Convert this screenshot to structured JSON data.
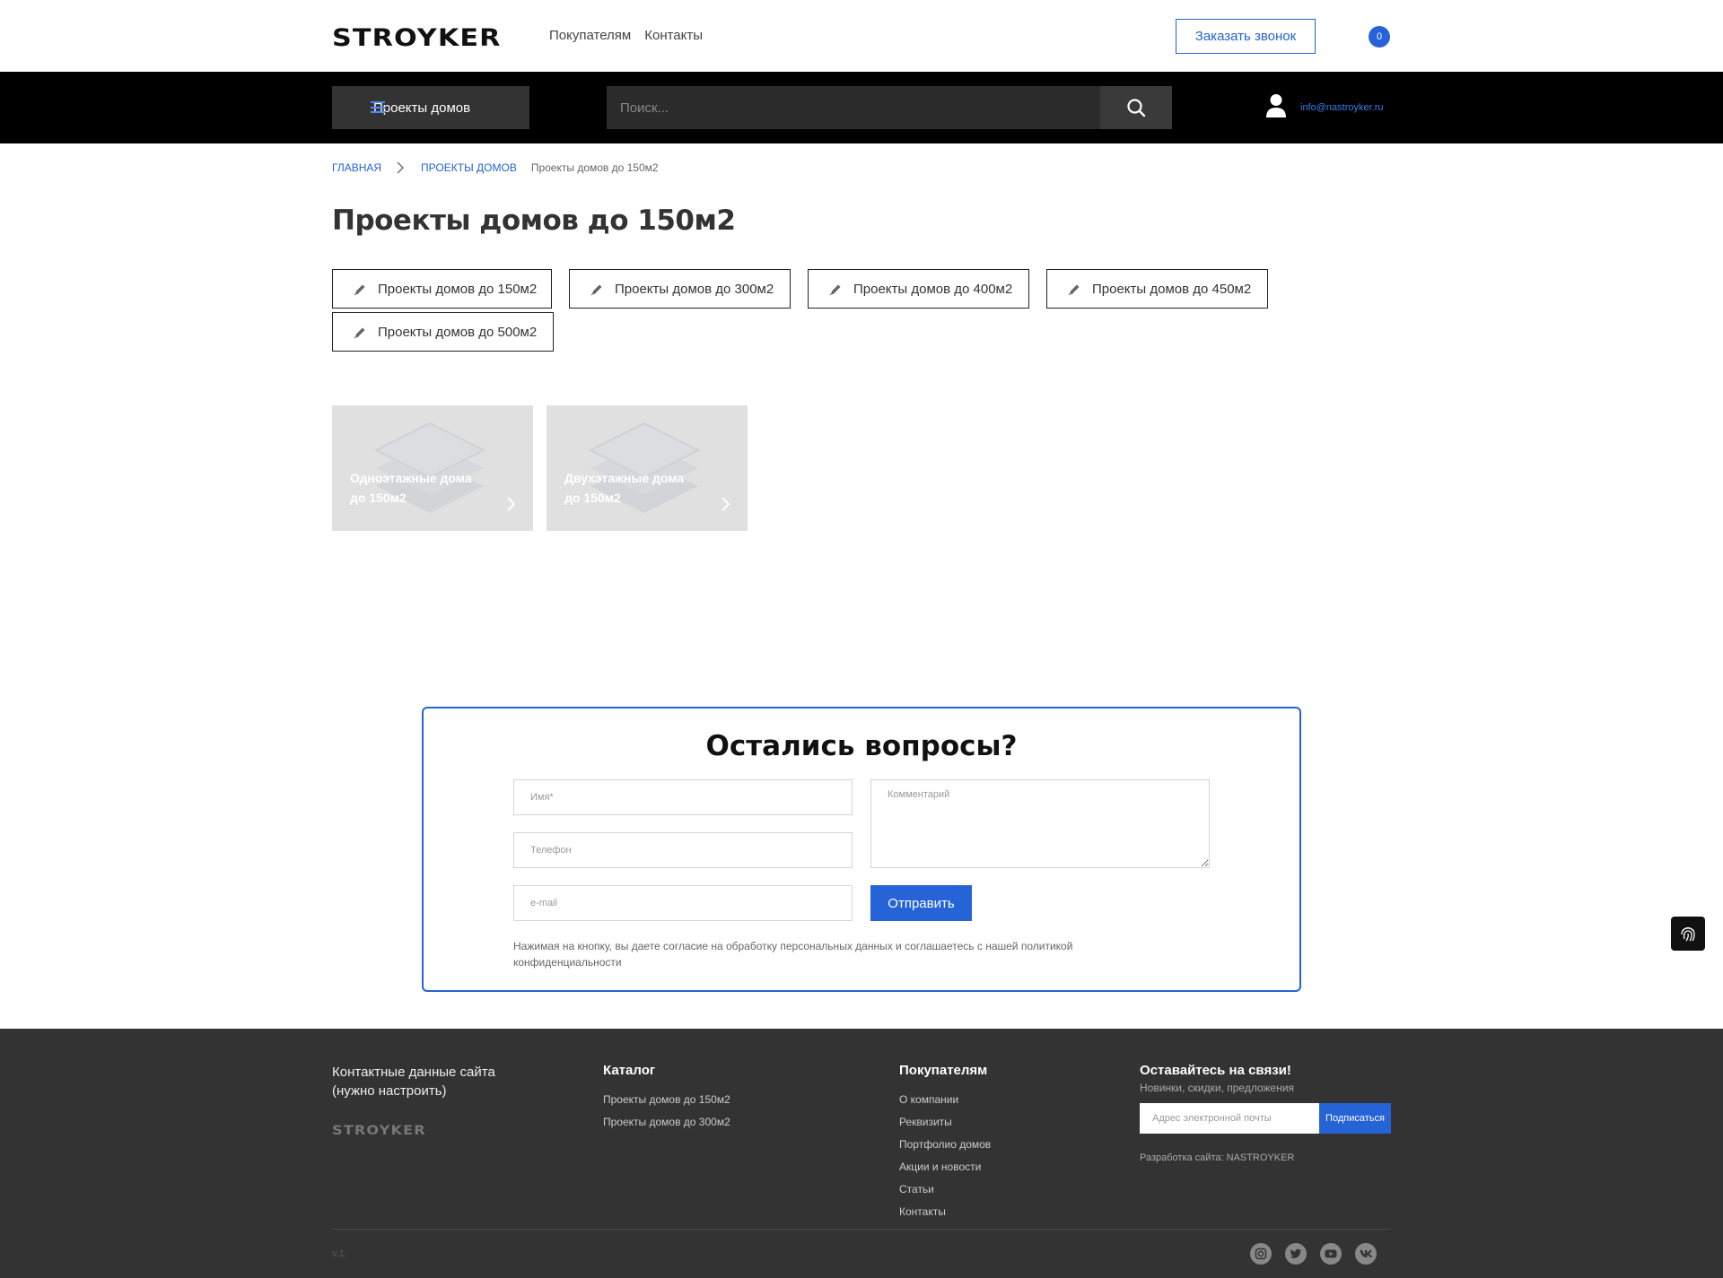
{
  "header": {
    "logo": "STROYKER",
    "nav": [
      "Покупателям",
      "Контакты"
    ],
    "callback_label": "Заказать звонок",
    "cart_count": "0"
  },
  "toolbar": {
    "catalog_label": "Проекты домов",
    "search_placeholder": "Поиск...",
    "email": "info@nastroyker.ru"
  },
  "breadcrumb": {
    "home": "Главная",
    "section": "Проекты домов",
    "current": "Проекты домов до 150м2"
  },
  "page_title": "Проекты домов до 150м2",
  "tags": [
    "Проекты домов до 150м2",
    "Проекты домов до 300м2",
    "Проекты домов до 400м2",
    "Проекты домов до 450м2",
    "Проекты домов до 500м2"
  ],
  "cards": [
    "Одноэтажные дома до 150м2",
    "Двухэтажные дома до 150м2"
  ],
  "form": {
    "title": "Остались вопросы?",
    "name_placeholder": "Имя*",
    "phone_placeholder": "Телефон",
    "email_placeholder": "e-mail",
    "comment_placeholder": "Комментарий",
    "submit_label": "Отправить",
    "consent": "Нажимая на кнопку, вы даете согласие на обработку персональных данных и соглашаетесь с нашей политикой конфиденциальности"
  },
  "footer": {
    "contacts": "Контактные данные сайта (нужно настроить)",
    "logo": "STROYKER",
    "catalog": {
      "title": "Каталог",
      "links": [
        "Проекты домов до 150м2",
        "Проекты домов до 300м2"
      ]
    },
    "buyers": {
      "title": "Покупателям",
      "links": [
        "О компании",
        "Реквизиты",
        "Портфолио домов",
        "Акции и новости",
        "Статьи",
        "Контакты"
      ]
    },
    "subscribe": {
      "title": "Оставайтесь на связи!",
      "subtitle": "Новинки, скидки, предложения",
      "placeholder": "Адрес электронной почты",
      "button": "Подписаться"
    },
    "developer": "Разработка сайта: NASTROYKER",
    "version": "v.1.",
    "social": [
      "instagram-icon",
      "twitter-icon",
      "youtube-icon",
      "vk-icon"
    ]
  },
  "colors": {
    "accent": "#2563d6",
    "dark_bar": "#000000",
    "footer_bg": "#333333"
  }
}
